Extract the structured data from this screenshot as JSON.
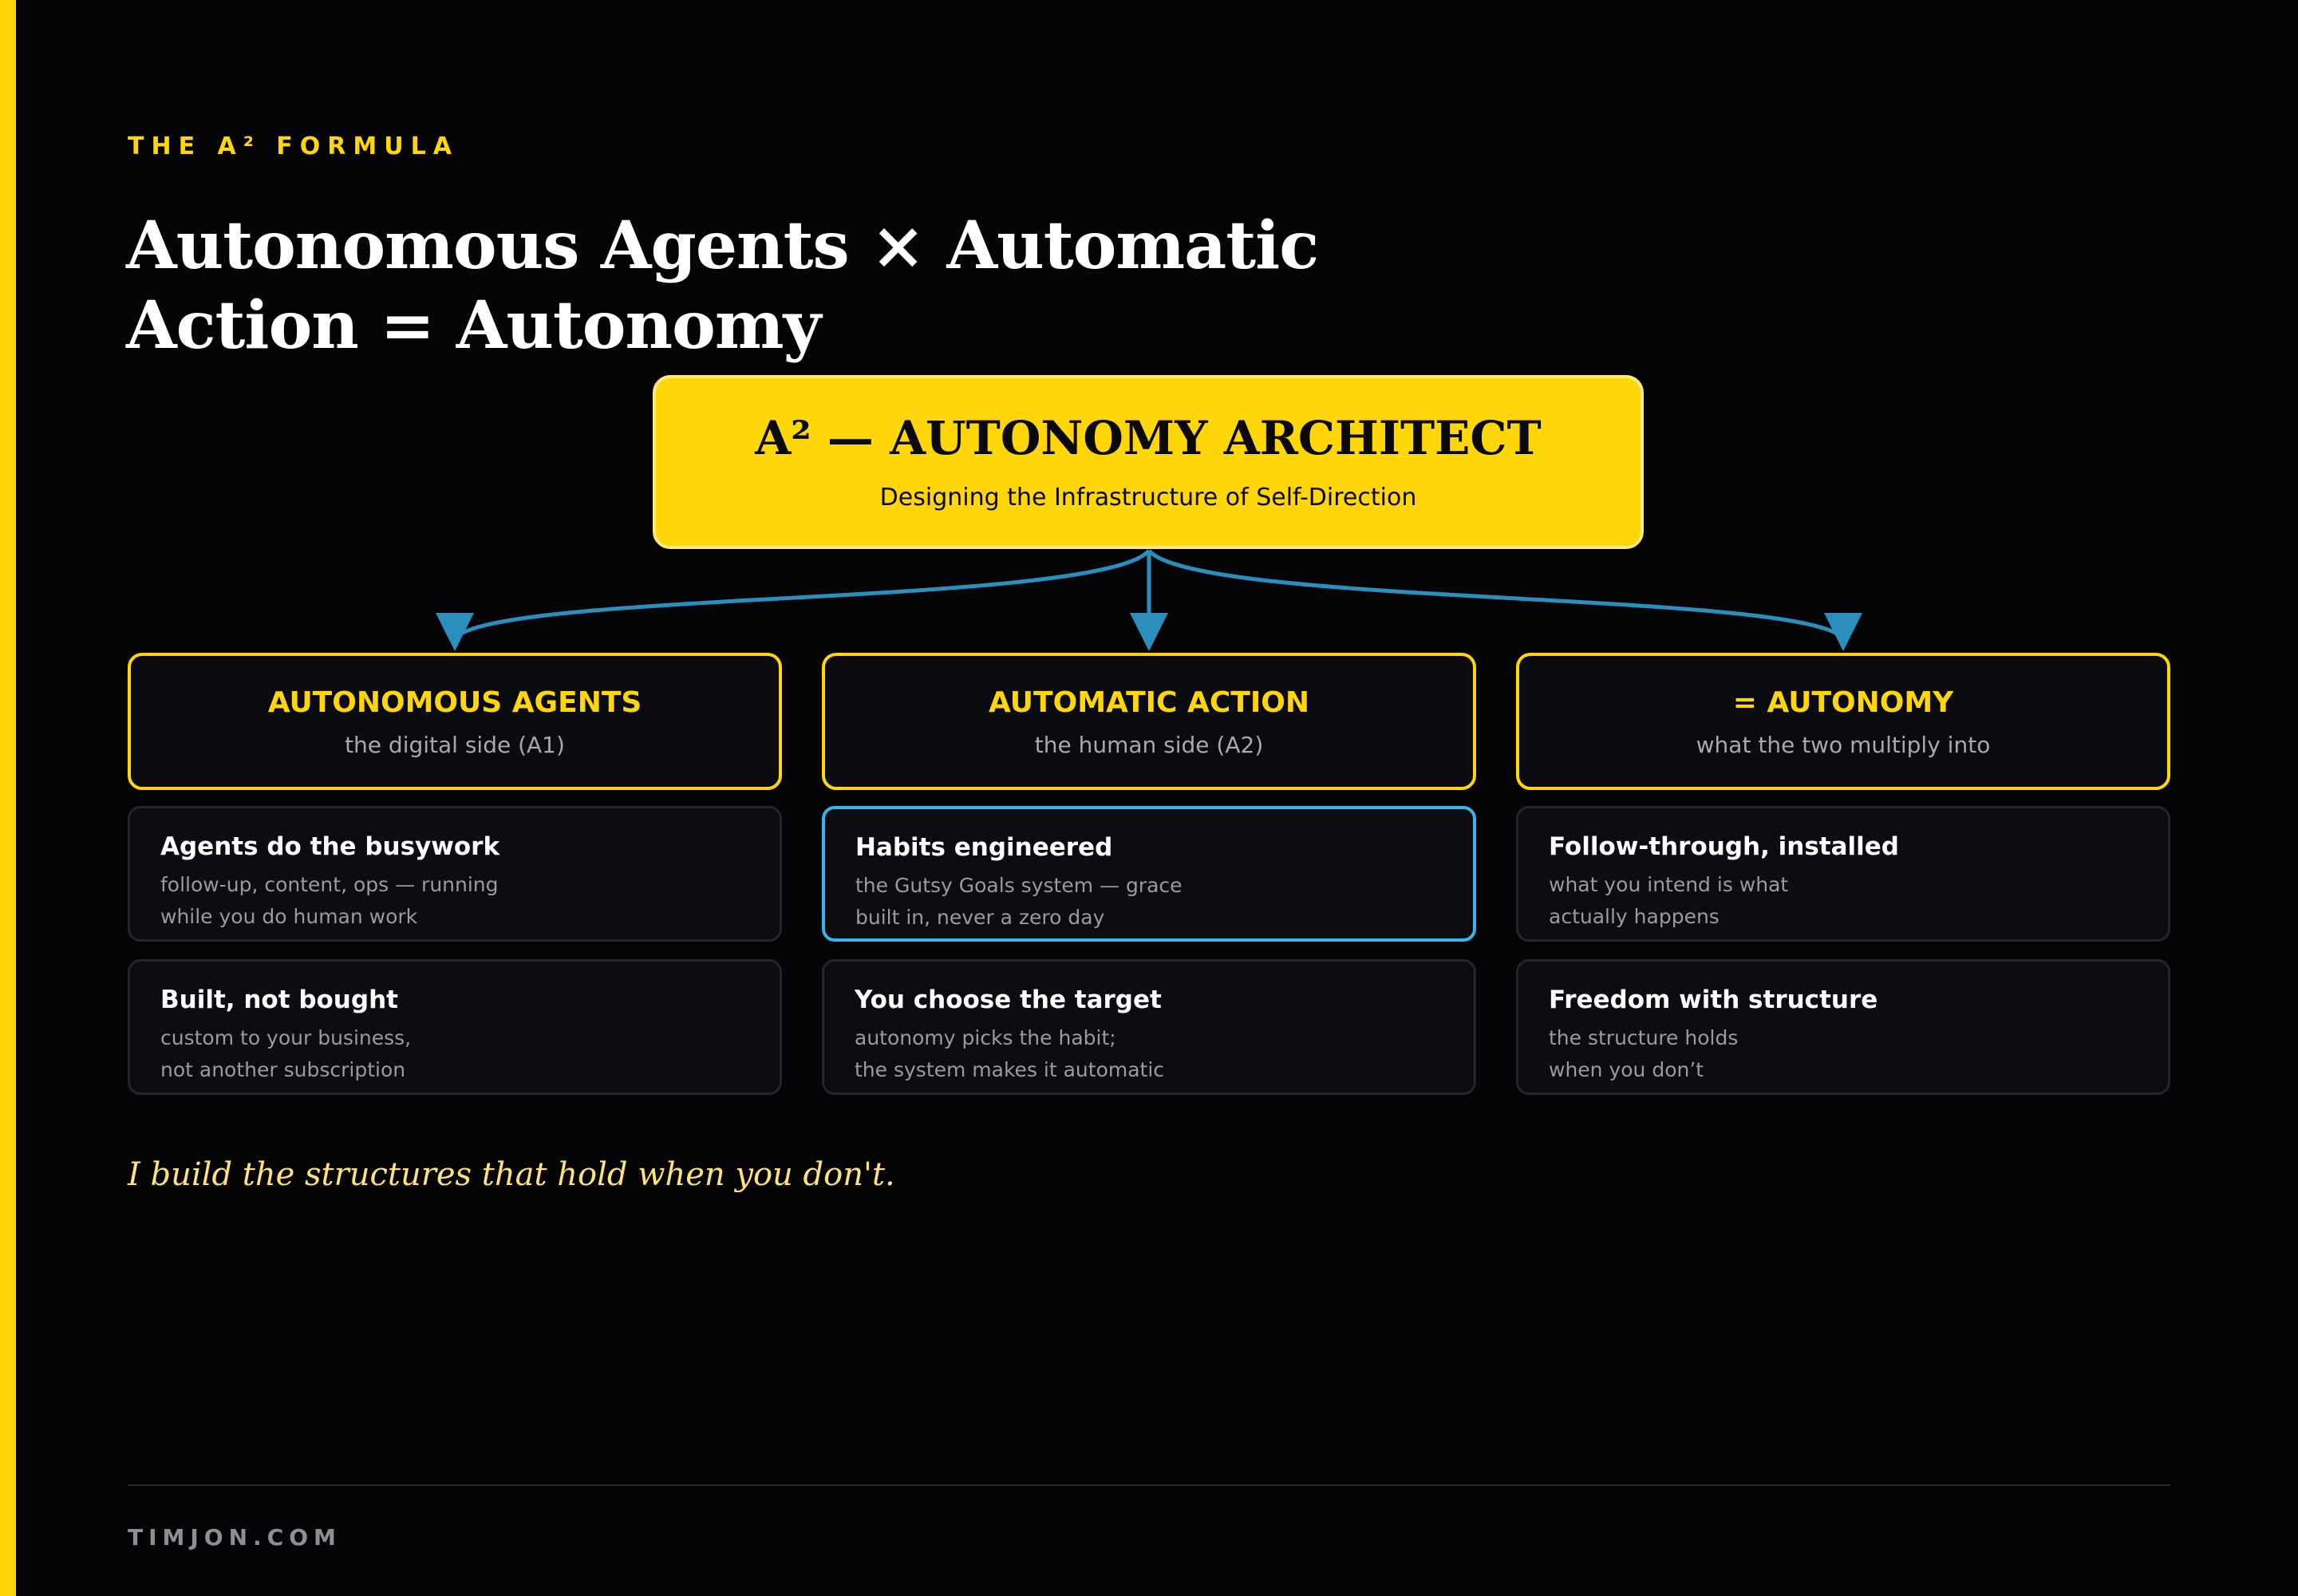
{
  "eyebrow": "THE A² FORMULA",
  "title": "Autonomous Agents × Automatic Action = Autonomy",
  "top_card": {
    "title": "A² — AUTONOMY ARCHITECT",
    "subtitle": "Designing the Infrastructure of Self-Direction"
  },
  "columns": [
    {
      "title": "AUTONOMOUS AGENTS",
      "subtitle": "the digital side (A1)",
      "items": [
        {
          "title": "Agents do the busywork",
          "desc": "follow-up, content, ops — running\nwhile you do human work",
          "highlight": false
        },
        {
          "title": "Built, not bought",
          "desc": "custom to your business,\nnot another subscription",
          "highlight": false
        }
      ]
    },
    {
      "title": "AUTOMATIC ACTION",
      "subtitle": "the human side (A2)",
      "items": [
        {
          "title": "Habits engineered",
          "desc": "the Gutsy Goals system — grace\nbuilt in, never a zero day",
          "highlight": true
        },
        {
          "title": "You choose the target",
          "desc": "autonomy picks the habit;\nthe system makes it automatic",
          "highlight": false
        }
      ]
    },
    {
      "title": "= AUTONOMY",
      "subtitle": "what the two multiply into",
      "items": [
        {
          "title": "Follow-through, installed",
          "desc": "what you intend is what\nactually happens",
          "highlight": false
        },
        {
          "title": "Freedom with structure",
          "desc": "the structure holds\nwhen you don’t",
          "highlight": false
        }
      ]
    }
  ],
  "quote": "I build the structures that hold when you don't.",
  "footer": "TIMJON.COM",
  "colors": {
    "accent": "#FFD60A",
    "connector": "#2A8FBD",
    "highlight": "#3AB3E6",
    "background": "#050507"
  }
}
